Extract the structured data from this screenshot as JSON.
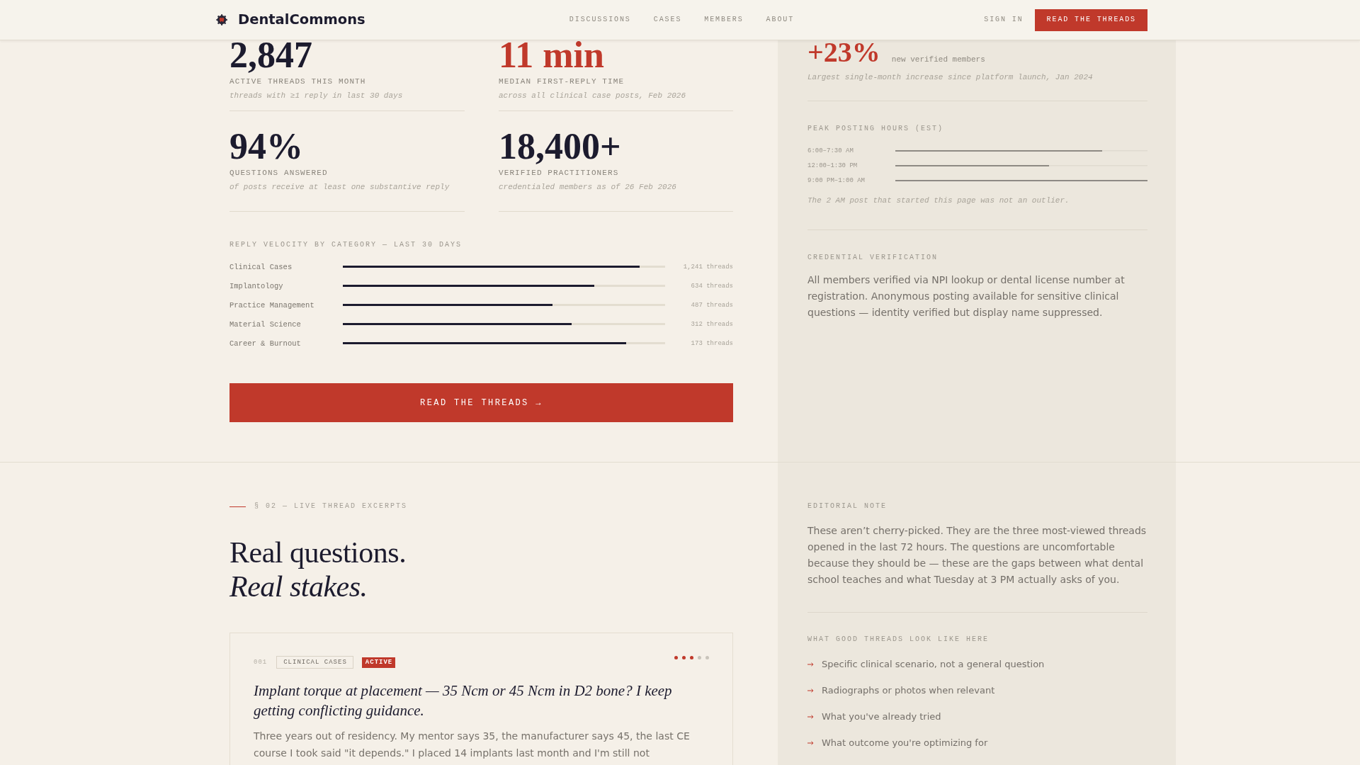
{
  "header": {
    "logo": "DentalCommons",
    "nav": [
      "DISCUSSIONS",
      "CASES",
      "MEMBERS",
      "ABOUT"
    ],
    "sign_in": "SIGN IN",
    "button": "READ THE THREADS"
  },
  "stats": {
    "items": [
      {
        "value": "2,847",
        "color": "#1c1b2e",
        "label": "ACTIVE THREADS THIS MONTH",
        "note": "threads with ≥1 reply in last 30 days"
      },
      {
        "value": "11 min",
        "color": "#c0392b",
        "label": "MEDIAN FIRST-REPLY TIME",
        "note": "across all clinical case posts, Feb 2026"
      },
      {
        "value": "94%",
        "color": "#1c1b2e",
        "label": "QUESTIONS ANSWERED",
        "note": "of posts receive at least one substantive reply"
      },
      {
        "value": "18,400+",
        "color": "#1c1b2e",
        "label": "VERIFIED PRACTITIONERS",
        "note": "credentialed members as of 26 Feb 2026"
      }
    ],
    "velocity": {
      "title": "REPLY VELOCITY BY CATEGORY — LAST 30 DAYS",
      "rows": [
        {
          "label": "Clinical Cases",
          "level": 0.92,
          "count": "1,241 threads"
        },
        {
          "label": "Implantology",
          "level": 0.78,
          "count": "634 threads"
        },
        {
          "label": "Practice Management",
          "level": 0.65,
          "count": "487 threads"
        },
        {
          "label": "Material Science",
          "level": 0.71,
          "count": "312 threads"
        },
        {
          "label": "Career & Burnout",
          "level": 0.88,
          "count": "173 threads"
        }
      ]
    },
    "cta": "READ THE THREADS →"
  },
  "growth": {
    "value": "+23%",
    "caption": "new verified members",
    "note": "Largest single-month increase since platform launch, Jan 2024"
  },
  "peak_hours": {
    "title": "PEAK POSTING HOURS (EST)",
    "rows": [
      {
        "label": "6:00–7:30 AM",
        "level": 0.82
      },
      {
        "label": "12:00–1:30 PM",
        "level": 0.61
      },
      {
        "label": "9:00 PM–1:00 AM",
        "level": 1
      }
    ],
    "note": "The 2 AM post that started this page was not an outlier."
  },
  "credential": {
    "title": "CREDENTIAL VERIFICATION",
    "text": "All members verified via NPI lookup or dental license number at registration. Anonymous posting available for sensitive clinical questions — identity verified but display name suppressed."
  },
  "excerpts": {
    "eyebrow": "§ 02 — LIVE THREAD EXCERPTS",
    "heading": [
      {
        "text": "Real questions.",
        "italic": false
      },
      {
        "text": "Real stakes.",
        "italic": true
      }
    ],
    "threads": [
      {
        "number": "001",
        "category": "CLINICAL CASES",
        "status": "ACTIVE",
        "stars": 3,
        "title": "Implant torque at placement — 35 Ncm or 45 Ncm in D2 bone? I keep getting conflicting guidance.",
        "body": "Three years out of residency. My mentor says 35, the manufacturer says 45, the last CE course I took said \"it depends.\" I placed 14 implants last month and I'm still not"
      }
    ]
  },
  "editorial": {
    "title": "EDITORIAL NOTE",
    "text": "These aren’t cherry-picked. They are the three most-viewed threads opened in the last 72 hours. The questions are uncomfortable because they should be — these are the gaps between what dental school teaches and what Tuesday at 3 PM actually asks of you."
  },
  "good_threads": {
    "title": "WHAT GOOD THREADS LOOK LIKE HERE",
    "items": [
      "Specific clinical scenario, not a general question",
      "Radiographs or photos when relevant",
      "What you've already tried",
      "What outcome you're optimizing for"
    ]
  }
}
